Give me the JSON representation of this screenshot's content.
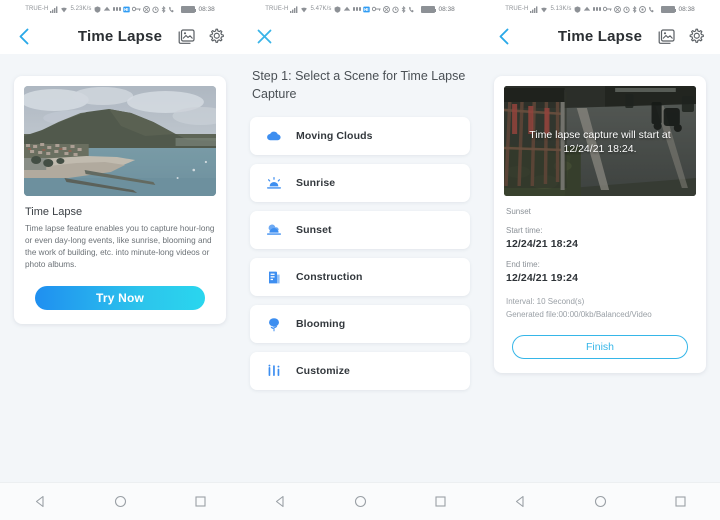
{
  "panels": [
    {
      "status_bar": {
        "carrier": "TRUE-H",
        "speed": "5.23K/s",
        "time": "08:38",
        "icons": [
          "signal-bars-icon",
          "wifi-icon",
          "vpn-icon",
          "upload-icon",
          "sim-icon",
          "hd-icon",
          "key-icon",
          "no-sound-icon",
          "alarm-icon",
          "bluetooth-icon",
          "phone-icon",
          "battery-icon"
        ]
      },
      "app_bar": {
        "back_label": "back-chevron",
        "title": "Time Lapse",
        "album_icon": "album-icon",
        "settings_icon": "gear-icon"
      },
      "card": {
        "image_alt": "coastal-town-landscape",
        "title": "Time Lapse",
        "description": "Time lapse feature enables you to capture hour-long or even day-long events, like sunrise, blooming and the work of building, etc. into minute-long videos or photo albums.",
        "cta_label": "Try Now"
      }
    },
    {
      "status_bar": {
        "carrier": "TRUE-H",
        "speed": "5.47K/s",
        "time": "08:38"
      },
      "app_bar": {
        "close_icon": "close-icon"
      },
      "step_title": "Step 1: Select a Scene for Time Lapse Capture",
      "scenes": [
        {
          "icon": "cloud-icon",
          "label": "Moving Clouds"
        },
        {
          "icon": "sunrise-icon",
          "label": "Sunrise"
        },
        {
          "icon": "sunset-icon",
          "label": "Sunset"
        },
        {
          "icon": "building-icon",
          "label": "Construction"
        },
        {
          "icon": "flower-icon",
          "label": "Blooming"
        },
        {
          "icon": "sliders-icon",
          "label": "Customize"
        }
      ]
    },
    {
      "status_bar": {
        "carrier": "TRUE-H",
        "speed": "5.13K/s",
        "time": "08:38"
      },
      "app_bar": {
        "back_label": "back-chevron",
        "title": "Time Lapse",
        "album_icon": "album-icon",
        "settings_icon": "gear-icon"
      },
      "summary": {
        "image_alt": "cctv-road-gate-view",
        "overlay_text": "Time lapse capture will start at 12/24/21 18:24.",
        "scene": "Sunset",
        "start_label": "Start time:",
        "start_value": "12/24/21 18:24",
        "end_label": "End time:",
        "end_value": "12/24/21 19:24",
        "interval": "Interval: 10 Second(s)",
        "generated": "Generated file:00:00/0kb/Balanced/Video",
        "finish_label": "Finish"
      }
    }
  ],
  "nav_bar": {
    "back": "nav-back-icon",
    "home": "nav-home-icon",
    "recents": "nav-recents-icon"
  },
  "colors": {
    "accent_blue": "#2aa9e8",
    "scene_icon_blue": "#3d8ef0",
    "panel_bg": "#f3f6f9",
    "cta_gradient_start": "#1f8ff0",
    "cta_gradient_end": "#2ad6ee",
    "finish_border": "#36b6e8"
  }
}
